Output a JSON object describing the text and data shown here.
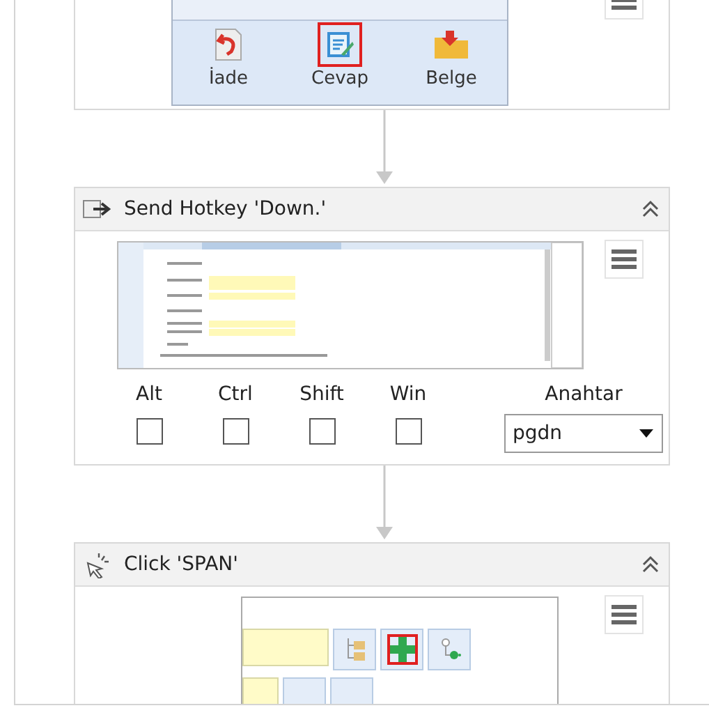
{
  "top_activity": {
    "ribbon_buttons": [
      {
        "label": "İade",
        "selected": false
      },
      {
        "label": "Cevap",
        "selected": true
      },
      {
        "label": "Belge",
        "selected": false
      }
    ]
  },
  "hotkey_activity": {
    "title": "Send Hotkey 'Down.'",
    "modifiers": [
      {
        "label": "Alt",
        "checked": false
      },
      {
        "label": "Ctrl",
        "checked": false
      },
      {
        "label": "Shift",
        "checked": false
      },
      {
        "label": "Win",
        "checked": false
      }
    ],
    "key": {
      "label": "Anahtar",
      "value": "pgdn"
    }
  },
  "click_activity": {
    "title": "Click 'SPAN'",
    "target_buttons": [
      {
        "selected": false
      },
      {
        "selected": true
      },
      {
        "selected": false
      }
    ]
  }
}
